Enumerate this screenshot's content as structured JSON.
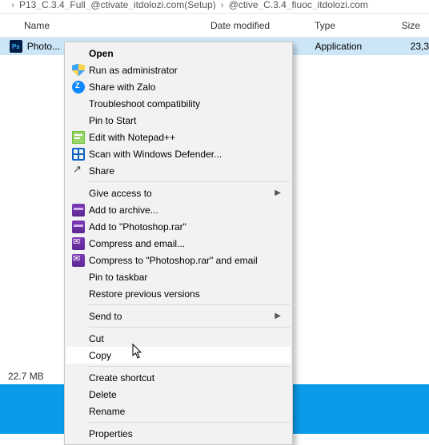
{
  "breadcrumb": {
    "seg1": "P13_C.3.4_Full_@ctivate_itdolozi.com(Setup)",
    "seg2": "@ctive_C.3.4_fiuoc_itdolozi.com"
  },
  "columns": {
    "name": "Name",
    "date": "Date modified",
    "type": "Type",
    "size": "Size"
  },
  "file": {
    "name": "Photo...",
    "date": "",
    "type": "Application",
    "size": "23,3"
  },
  "status": {
    "text": "22.7 MB"
  },
  "menu": {
    "open": "Open",
    "run_admin": "Run as administrator",
    "share_zalo": "Share with Zalo",
    "troubleshoot": "Troubleshoot compatibility",
    "pin_start": "Pin to Start",
    "edit_npp": "Edit with Notepad++",
    "scan_def": "Scan with Windows Defender...",
    "share": "Share",
    "give_access": "Give access to",
    "add_archive": "Add to archive...",
    "add_photoshop_rar": "Add to \"Photoshop.rar\"",
    "compress_email": "Compress and email...",
    "compress_photoshop_email": "Compress to \"Photoshop.rar\" and email",
    "pin_taskbar": "Pin to taskbar",
    "restore_prev": "Restore previous versions",
    "send_to": "Send to",
    "cut": "Cut",
    "copy": "Copy",
    "create_shortcut": "Create shortcut",
    "delete": "Delete",
    "rename": "Rename",
    "properties": "Properties"
  }
}
